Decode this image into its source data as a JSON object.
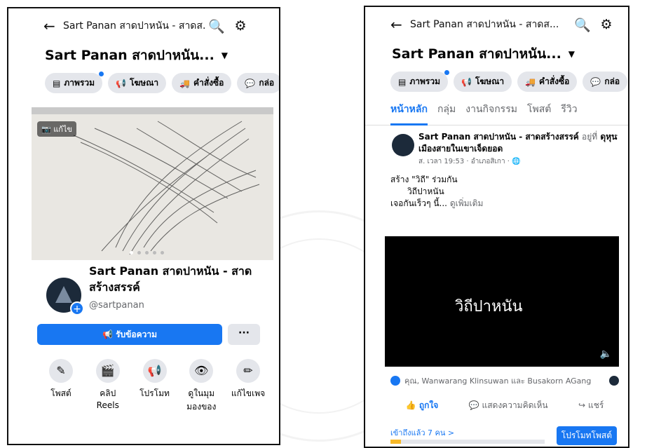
{
  "left": {
    "header": {
      "back": "←",
      "title": "Sart Panan สาดปาหนัน - สาดส...",
      "search": "🔍",
      "settings": "⚙"
    },
    "page_name": "Sart Panan สาดปาหนัน...",
    "caret": "▼",
    "chips": [
      {
        "icon": "▤",
        "label": "ภาพรวม"
      },
      {
        "icon": "📢",
        "label": "โฆษณา"
      },
      {
        "icon": "🚚",
        "label": "คำสั่งซื้อ"
      },
      {
        "icon": "💬",
        "label": "กล่อ"
      }
    ],
    "cover_edit": "📷 แก้ไข",
    "profile": {
      "name": "Sart Panan สาดปาหนัน - สาดสร้างสรรค์",
      "handle": "@sartpanan",
      "plus": "+"
    },
    "message_button": "📢 รับข้อความ",
    "more_button": "···",
    "actions": [
      {
        "icon": "✎",
        "label": "โพสต์"
      },
      {
        "icon": "🎬",
        "label": "คลิป Reels"
      },
      {
        "icon": "📢",
        "label": "โปรโมท"
      },
      {
        "icon": "👁",
        "label": "ดูในมุมมองของ"
      },
      {
        "icon": "✏",
        "label": "แก้ไขเพจ"
      }
    ]
  },
  "right": {
    "header": {
      "back": "←",
      "title": "Sart Panan สาดปาหนัน - สาดส...",
      "search": "🔍",
      "settings": "⚙"
    },
    "page_name": "Sart Panan สาดปาหนัน...",
    "caret": "▼",
    "chips": [
      {
        "icon": "▤",
        "label": "ภาพรวม"
      },
      {
        "icon": "📢",
        "label": "โฆษณา"
      },
      {
        "icon": "🚚",
        "label": "คำสั่งซื้อ"
      },
      {
        "icon": "💬",
        "label": "กล่อ"
      }
    ],
    "tabs": [
      "หน้าหลัก",
      "กลุ่ม",
      "งานกิจกรรม",
      "โพสต์",
      "รีวิว"
    ],
    "post": {
      "author": "Sart Panan สาดปาหนัน - สาดสร้างสรรค์",
      "at": "อยู่ที่",
      "place": "ดุหุนเมืองสายในเขาเจ็ดยอด",
      "meta": "ส. เวลา 19:53 · อำเภอสิเกา · 🌐",
      "dots": "···",
      "line1": "สร้าง \"วิถี\" ร่วมกัน",
      "line2": "วิถีปาหนัน",
      "line3": "เจอกันเร็วๆ นี้...",
      "see_more": "ดูเพิ่มเติม",
      "video_title": "วิถีปาหนัน",
      "volume": "🔈",
      "reactions": "คุณ, Wanwarang Klinsuwan และ Busakorn AGang",
      "like": "ถูกใจ",
      "comment": "แสดงความคิดเห็น",
      "share": "แชร์",
      "reach": "เข้าถึงแล้ว 7 คน >",
      "promote": "โปรโมทโพสต์",
      "reach_progress": 0.07
    }
  }
}
